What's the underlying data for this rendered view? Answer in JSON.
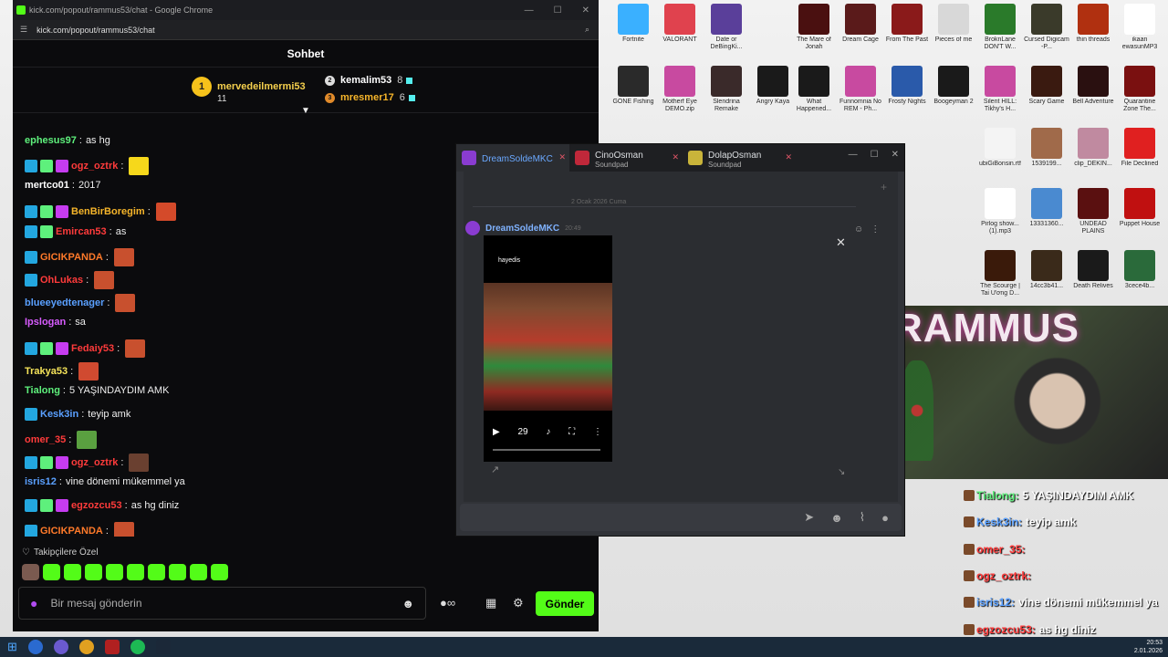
{
  "browser": {
    "title": "kick.com/popout/rammus53/chat - Google Chrome",
    "url": "kick.com/popout/rammus53/chat"
  },
  "chat": {
    "header": "Sohbet",
    "leaderboard": {
      "first": {
        "rank": "1",
        "name": "mervedeilmermi53",
        "count": "11"
      },
      "second": {
        "rank": "2",
        "name": "kemalim53",
        "count": "8"
      },
      "third": {
        "rank": "3",
        "name": "mresmer17",
        "count": "6"
      }
    },
    "messages": [
      {
        "user": "ephesus97",
        "text": "as hg",
        "color": "#5ef07c"
      },
      {
        "user": "ogz_oztrk",
        "text": "",
        "color": "#ff3b3b"
      },
      {
        "user": "mertco01",
        "text": "2017",
        "color": "#ffffff"
      },
      {
        "user": "BenBirBoregim",
        "text": "",
        "color": "#f6b52a"
      },
      {
        "user": "Emircan53",
        "text": "as",
        "color": "#ff3b3b"
      },
      {
        "user": "GICIKPANDA",
        "text": "",
        "color": "#ff7a2a"
      },
      {
        "user": "OhLukas",
        "text": "",
        "color": "#ff3b3b"
      },
      {
        "user": "blueeyedtenager",
        "text": "",
        "color": "#5aa0ff"
      },
      {
        "user": "Ipslogan",
        "text": "sa",
        "color": "#d85cff"
      },
      {
        "user": "Fedaiy53",
        "text": "",
        "color": "#ff3b3b"
      },
      {
        "user": "Trakya53",
        "text": "",
        "color": "#f6e45a"
      },
      {
        "user": "Tialong",
        "text": "5 YAŞINDAYDIM AMK",
        "color": "#5ef07c"
      },
      {
        "user": "Kesk3in",
        "text": "teyip amk",
        "color": "#5aa0ff"
      },
      {
        "user": "omer_35",
        "text": "",
        "color": "#ff3b3b"
      },
      {
        "user": "ogz_oztrk",
        "text": "",
        "color": "#ff3b3b"
      },
      {
        "user": "isris12",
        "text": "vine dönemi mükemmel ya",
        "color": "#5aa0ff"
      },
      {
        "user": "egzozcu53",
        "text": "as hg diniz",
        "color": "#ff3b3b"
      },
      {
        "user": "GICIKPANDA",
        "text": "",
        "color": "#ff7a2a"
      }
    ],
    "follow_only": "Takipçilere Özel",
    "input_placeholder": "Bir mesaj gönderin",
    "send_label": "Gönder"
  },
  "discord": {
    "tabs": [
      {
        "name": "DreamSoldeMKC",
        "sub": ""
      },
      {
        "name": "CinoOsman",
        "sub": "Soundpad"
      },
      {
        "name": "DolapOsman",
        "sub": "Soundpad"
      }
    ],
    "date": "2 Ocak 2026 Cuma",
    "author": "DreamSoldeMKC",
    "time": "20:49",
    "video_caption": "hayedis",
    "video_time": "29"
  },
  "desktop_icons": [
    {
      "label": "Fortnite",
      "color": "#3ab0ff"
    },
    {
      "label": "VALORANT",
      "color": "#e0424e"
    },
    {
      "label": "Date or DeBingKi...",
      "color": "#5a3f9a"
    },
    {
      "label": "The Mare of Jonah",
      "color": "#4a1010"
    },
    {
      "label": "Dream Cage",
      "color": "#5a1a1a"
    },
    {
      "label": "From The Past",
      "color": "#8a1a1a"
    },
    {
      "label": "Pieces of me",
      "color": "#d8d8d8"
    },
    {
      "label": "BroknLane DON'T W...",
      "color": "#2a7a2a"
    },
    {
      "label": "Cursed Digicam -P...",
      "color": "#3a3a2a"
    },
    {
      "label": "thin threads",
      "color": "#b03010"
    },
    {
      "label": "ikaan ewasunMP3",
      "color": "#ffffff"
    },
    {
      "label": "GONE Fishing",
      "color": "#2a2a2a"
    },
    {
      "label": "Motherf Eye DEMO.zip",
      "color": "#c84aa0"
    },
    {
      "label": "Slendrina Remake",
      "color": "#3a2a2a"
    },
    {
      "label": "Angry Kaya",
      "color": "#1a1a1a"
    },
    {
      "label": "What Happened...",
      "color": "#1a1a1a"
    },
    {
      "label": "Funnomnia No REM - Ph...",
      "color": "#c84aa0"
    },
    {
      "label": "Frosty Nights",
      "color": "#2a5aaa"
    },
    {
      "label": "Boogeyman 2",
      "color": "#1a1a1a"
    },
    {
      "label": "Silent HILL: Tikhy's H...",
      "color": "#c84aa0"
    },
    {
      "label": "Scary Game",
      "color": "#3a1a10"
    },
    {
      "label": "Bell Adventure",
      "color": "#2a1010"
    },
    {
      "label": "Quarantine Zone The...",
      "color": "#7a1010"
    },
    {
      "label": "ubiGiBonsin.rtf",
      "color": "#f4f4f4"
    },
    {
      "label": "1539199...",
      "color": "#a06a4a"
    },
    {
      "label": "clip_DEKIN...",
      "color": "#c08aa0"
    },
    {
      "label": "File Declined",
      "color": "#e02020"
    },
    {
      "label": "Pirlog show...(1).mp3",
      "color": "#ffffff"
    },
    {
      "label": "13331360...",
      "color": "#4a8ad0"
    },
    {
      "label": "UNDEAD PLAINS",
      "color": "#5a1010"
    },
    {
      "label": "Puppet House",
      "color": "#c01010"
    },
    {
      "label": "The Scourge | Tai Ương D...",
      "color": "#3a1a0a"
    },
    {
      "label": "14cc3b41...",
      "color": "#3a2a1a"
    },
    {
      "label": "Death Relives",
      "color": "#1a1a1a"
    },
    {
      "label": "3cece4b...",
      "color": "#2a6a3a"
    }
  ],
  "overlay": [
    {
      "user": "Tialong:",
      "text": "5 YAŞINDAYDIM AMK",
      "color": "#5ef07c"
    },
    {
      "user": "Kesk3in:",
      "text": "teyip amk",
      "color": "#5aa0ff"
    },
    {
      "user": "omer_35:",
      "text": "",
      "color": "#ff3b3b"
    },
    {
      "user": "ogz_oztrk:",
      "text": "",
      "color": "#ff3b3b"
    },
    {
      "user": "isris12:",
      "text": "vine dönemi mükemmel ya",
      "color": "#5aa0ff"
    },
    {
      "user": "egzozcu53:",
      "text": "as hg diniz",
      "color": "#ff3b3b"
    }
  ],
  "tray": {
    "time": "20:53",
    "date": "2.01.2026"
  },
  "accent": "#53fc18"
}
